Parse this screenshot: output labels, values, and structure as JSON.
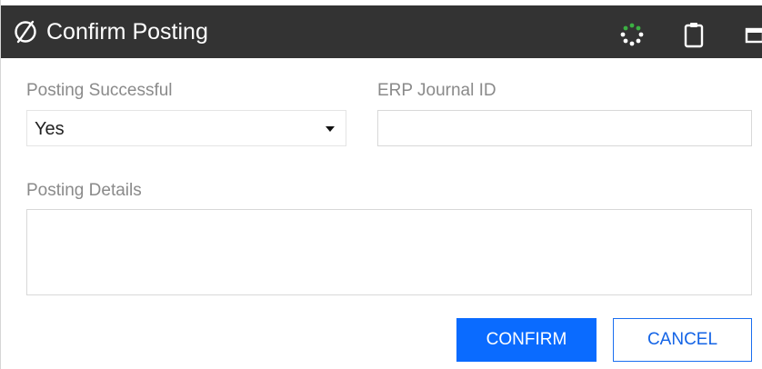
{
  "dialog": {
    "title": "Confirm Posting",
    "logo_icon": "slashed-circle-logo-icon",
    "toolbar_icons": [
      "spinner-icon",
      "clipboard-icon",
      "window-icon"
    ],
    "spinner_accent": "#3cb043"
  },
  "form": {
    "posting_successful": {
      "label": "Posting Successful",
      "value": "Yes"
    },
    "erp_journal_id": {
      "label": "ERP Journal ID",
      "value": ""
    },
    "posting_details": {
      "label": "Posting Details",
      "value": ""
    }
  },
  "actions": {
    "confirm_label": "CONFIRM",
    "cancel_label": "CANCEL",
    "confirm_color": "#0a6bff"
  }
}
